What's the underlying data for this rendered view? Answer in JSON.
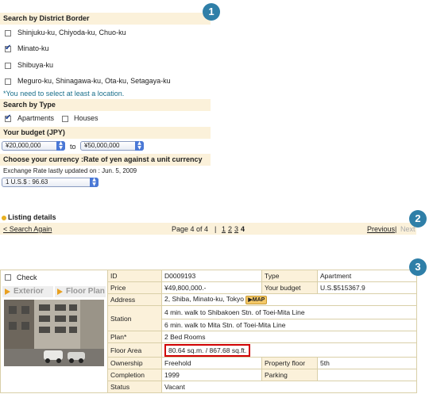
{
  "search": {
    "district_header": "Search by District Border",
    "districts": [
      {
        "label": "Shinjuku-ku, Chiyoda-ku, Chuo-ku",
        "checked": false
      },
      {
        "label": "Minato-ku",
        "checked": true
      },
      {
        "label": "Shibuya-ku",
        "checked": false
      },
      {
        "label": "Meguro-ku, Shinagawa-ku, Ota-ku, Setagaya-ku",
        "checked": false
      }
    ],
    "location_note": "*You need to select at least a location.",
    "type_header": "Search by Type",
    "types": [
      {
        "label": "Apartments",
        "checked": true
      },
      {
        "label": "Houses",
        "checked": false
      }
    ],
    "budget_header": "Your budget (JPY)",
    "budget_from": "¥20,000,000",
    "budget_to_label": "to",
    "budget_to": "¥50,000,000",
    "currency_header": "Choose your currency :Rate of yen against a unit currency",
    "exchange_note": "Exchange Rate lastly updated on : Jun. 5, 2009",
    "currency_value": "1 U.S.$ : 96.63"
  },
  "callouts": [
    "1",
    "2",
    "3"
  ],
  "listing": {
    "title": "Listing details",
    "search_again": "< Search Again",
    "page_info": "Page 4 of 4",
    "pipe": "|",
    "pages": [
      "1",
      "2",
      "3",
      "4"
    ],
    "previous": "Previous",
    "separator": "|",
    "next": "Next"
  },
  "detail": {
    "check_label": "Check",
    "tab_exterior": "Exterior",
    "tab_floorplan": "Floor Plan",
    "id_label": "ID",
    "id_value": "D0009193",
    "type_label": "Type",
    "type_value": "Apartment",
    "price_label": "Price",
    "price_value": "¥49,800,000.-",
    "budget_label": "Your budget",
    "budget_value": "U.S.$515367.9",
    "address_label": "Address",
    "address_value": "2, Shiba, Minato-ku, Tokyo",
    "map_label": "MAP",
    "station_label": "Station",
    "station_1": "4 min. walk to Shibakoen Stn. of Toei-Mita Line",
    "station_2": "6 min. walk to Mita Stn. of Toei-Mita Line",
    "plan_label": "Plan*",
    "plan_value": "2 Bed Rooms",
    "area_label": "Floor Area",
    "area_value": "80.64 sq.m. / 867.68 sq.ft.",
    "ownership_label": "Ownership",
    "ownership_value": "Freehold",
    "floor_label": "Property floor",
    "floor_value": "5th",
    "completion_label": "Completion",
    "completion_value": "1999",
    "parking_label": "Parking",
    "parking_value": "",
    "status_label": "Status",
    "status_value": "Vacant"
  },
  "colors": {
    "section_bg": "#fbf1da",
    "callout": "#2f7fa8",
    "note_text": "#1a6f8a",
    "highlight_border": "#d00000",
    "select_arrow": "#4a78d6"
  }
}
